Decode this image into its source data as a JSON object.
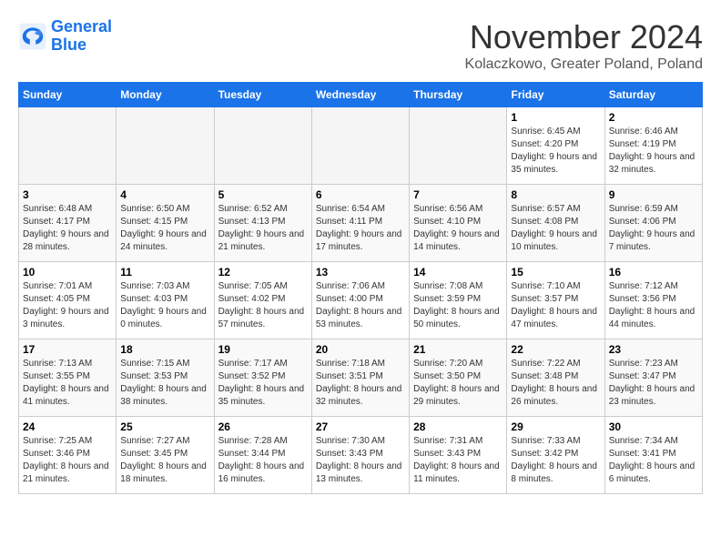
{
  "logo": {
    "line1": "General",
    "line2": "Blue"
  },
  "title": "November 2024",
  "subtitle": "Kolaczkowo, Greater Poland, Poland",
  "weekdays": [
    "Sunday",
    "Monday",
    "Tuesday",
    "Wednesday",
    "Thursday",
    "Friday",
    "Saturday"
  ],
  "weeks": [
    [
      {
        "day": "",
        "info": ""
      },
      {
        "day": "",
        "info": ""
      },
      {
        "day": "",
        "info": ""
      },
      {
        "day": "",
        "info": ""
      },
      {
        "day": "",
        "info": ""
      },
      {
        "day": "1",
        "info": "Sunrise: 6:45 AM\nSunset: 4:20 PM\nDaylight: 9 hours and 35 minutes."
      },
      {
        "day": "2",
        "info": "Sunrise: 6:46 AM\nSunset: 4:19 PM\nDaylight: 9 hours and 32 minutes."
      }
    ],
    [
      {
        "day": "3",
        "info": "Sunrise: 6:48 AM\nSunset: 4:17 PM\nDaylight: 9 hours and 28 minutes."
      },
      {
        "day": "4",
        "info": "Sunrise: 6:50 AM\nSunset: 4:15 PM\nDaylight: 9 hours and 24 minutes."
      },
      {
        "day": "5",
        "info": "Sunrise: 6:52 AM\nSunset: 4:13 PM\nDaylight: 9 hours and 21 minutes."
      },
      {
        "day": "6",
        "info": "Sunrise: 6:54 AM\nSunset: 4:11 PM\nDaylight: 9 hours and 17 minutes."
      },
      {
        "day": "7",
        "info": "Sunrise: 6:56 AM\nSunset: 4:10 PM\nDaylight: 9 hours and 14 minutes."
      },
      {
        "day": "8",
        "info": "Sunrise: 6:57 AM\nSunset: 4:08 PM\nDaylight: 9 hours and 10 minutes."
      },
      {
        "day": "9",
        "info": "Sunrise: 6:59 AM\nSunset: 4:06 PM\nDaylight: 9 hours and 7 minutes."
      }
    ],
    [
      {
        "day": "10",
        "info": "Sunrise: 7:01 AM\nSunset: 4:05 PM\nDaylight: 9 hours and 3 minutes."
      },
      {
        "day": "11",
        "info": "Sunrise: 7:03 AM\nSunset: 4:03 PM\nDaylight: 9 hours and 0 minutes."
      },
      {
        "day": "12",
        "info": "Sunrise: 7:05 AM\nSunset: 4:02 PM\nDaylight: 8 hours and 57 minutes."
      },
      {
        "day": "13",
        "info": "Sunrise: 7:06 AM\nSunset: 4:00 PM\nDaylight: 8 hours and 53 minutes."
      },
      {
        "day": "14",
        "info": "Sunrise: 7:08 AM\nSunset: 3:59 PM\nDaylight: 8 hours and 50 minutes."
      },
      {
        "day": "15",
        "info": "Sunrise: 7:10 AM\nSunset: 3:57 PM\nDaylight: 8 hours and 47 minutes."
      },
      {
        "day": "16",
        "info": "Sunrise: 7:12 AM\nSunset: 3:56 PM\nDaylight: 8 hours and 44 minutes."
      }
    ],
    [
      {
        "day": "17",
        "info": "Sunrise: 7:13 AM\nSunset: 3:55 PM\nDaylight: 8 hours and 41 minutes."
      },
      {
        "day": "18",
        "info": "Sunrise: 7:15 AM\nSunset: 3:53 PM\nDaylight: 8 hours and 38 minutes."
      },
      {
        "day": "19",
        "info": "Sunrise: 7:17 AM\nSunset: 3:52 PM\nDaylight: 8 hours and 35 minutes."
      },
      {
        "day": "20",
        "info": "Sunrise: 7:18 AM\nSunset: 3:51 PM\nDaylight: 8 hours and 32 minutes."
      },
      {
        "day": "21",
        "info": "Sunrise: 7:20 AM\nSunset: 3:50 PM\nDaylight: 8 hours and 29 minutes."
      },
      {
        "day": "22",
        "info": "Sunrise: 7:22 AM\nSunset: 3:48 PM\nDaylight: 8 hours and 26 minutes."
      },
      {
        "day": "23",
        "info": "Sunrise: 7:23 AM\nSunset: 3:47 PM\nDaylight: 8 hours and 23 minutes."
      }
    ],
    [
      {
        "day": "24",
        "info": "Sunrise: 7:25 AM\nSunset: 3:46 PM\nDaylight: 8 hours and 21 minutes."
      },
      {
        "day": "25",
        "info": "Sunrise: 7:27 AM\nSunset: 3:45 PM\nDaylight: 8 hours and 18 minutes."
      },
      {
        "day": "26",
        "info": "Sunrise: 7:28 AM\nSunset: 3:44 PM\nDaylight: 8 hours and 16 minutes."
      },
      {
        "day": "27",
        "info": "Sunrise: 7:30 AM\nSunset: 3:43 PM\nDaylight: 8 hours and 13 minutes."
      },
      {
        "day": "28",
        "info": "Sunrise: 7:31 AM\nSunset: 3:43 PM\nDaylight: 8 hours and 11 minutes."
      },
      {
        "day": "29",
        "info": "Sunrise: 7:33 AM\nSunset: 3:42 PM\nDaylight: 8 hours and 8 minutes."
      },
      {
        "day": "30",
        "info": "Sunrise: 7:34 AM\nSunset: 3:41 PM\nDaylight: 8 hours and 6 minutes."
      }
    ]
  ]
}
